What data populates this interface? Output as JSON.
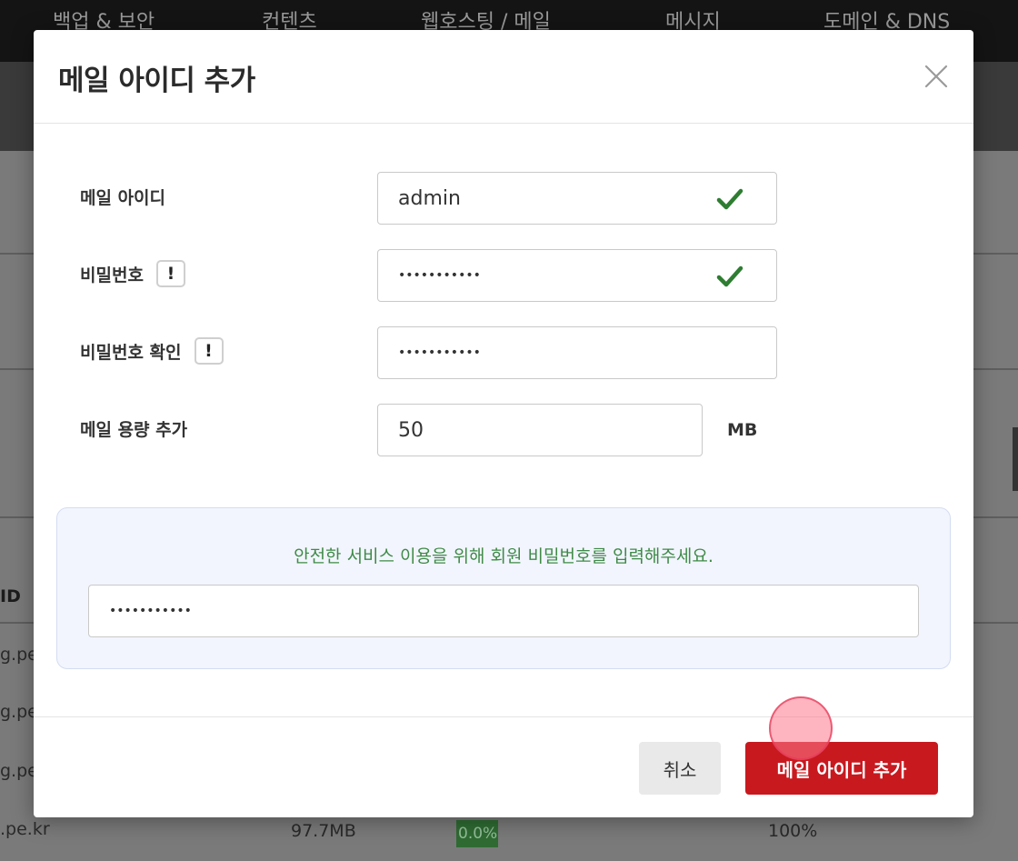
{
  "background": {
    "nav_items": [
      "백업 & 보안",
      "컨텐츠",
      "웹호스팅 / 메일",
      "메시지",
      "도메인 & DNS"
    ],
    "table_header_fragment": "ID",
    "row_fragments": [
      "g.pe",
      "g.pe",
      "g.pe",
      ".pe.kr"
    ],
    "last_row_size": "97.7MB",
    "last_row_usage": "0.0%",
    "last_row_percent": "100%",
    "usage_fraction": 0.0
  },
  "modal": {
    "title": "메일 아이디 추가",
    "close_icon": "close-icon",
    "fields": {
      "mail_id": {
        "label": "메일 아이디",
        "value": "admin",
        "valid": true
      },
      "password": {
        "label": "비밀번호",
        "value": "•••••••••••",
        "valid": true,
        "info_badge": "!"
      },
      "password_confirm": {
        "label": "비밀번호 확인",
        "value": "•••••••••••",
        "info_badge": "!"
      },
      "quota": {
        "label": "메일 용량 추가",
        "value": "50",
        "unit": "MB"
      }
    },
    "verify": {
      "message": "안전한 서비스 이용을 위해 회원 비밀번호를 입력해주세요.",
      "value": "•••••••••••"
    },
    "buttons": {
      "cancel": "취소",
      "submit": "메일 아이디 추가"
    }
  },
  "colors": {
    "primary": "#c8191f",
    "valid_check": "#2e7d32",
    "notice_text": "#3f8a48",
    "panel_bg": "#f2f5fd"
  }
}
